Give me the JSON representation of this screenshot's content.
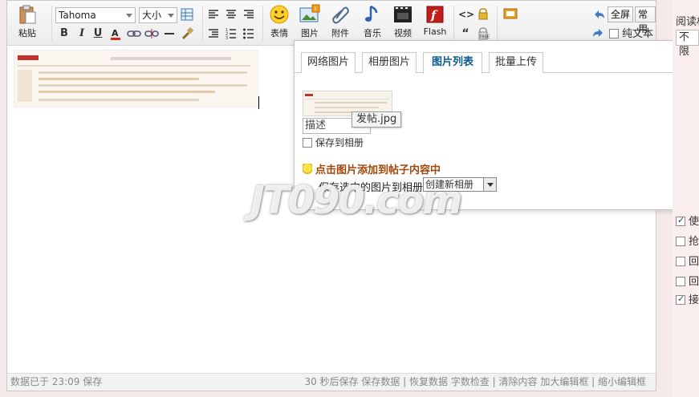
{
  "toolbar": {
    "paste": "粘贴",
    "font_name": "Tahoma",
    "font_size": "大小",
    "emoji": "表情",
    "image": "图片",
    "attachment": "附件",
    "music": "音乐",
    "video": "视频",
    "flash": "Flash",
    "fullscreen": "全屏",
    "common": "常用",
    "plain_text": "纯文本",
    "bold": "B",
    "italic": "I",
    "underline": "U",
    "code_icon": "<>",
    "quote_icon": "“"
  },
  "status": {
    "saved_at": "数据已于 23:09 保存",
    "actions": "30 秒后保存 保存数据 | 恢复数据   字数检查 | 清除内容   加大编辑框 | 缩小编辑框"
  },
  "popup": {
    "tabs": [
      "网络图片",
      "相册图片",
      "图片列表",
      "批量上传"
    ],
    "active_tab": "图片列表",
    "close": "×",
    "desc_placeholder": "描述",
    "filename_tip": "发帖.jpg",
    "save_to_album": "保存到相册",
    "hint": "点击图片添加到帖子内容中",
    "save_selected_label": "保存选中的图片到相册:",
    "album_option": "创建新相册"
  },
  "watermark": "JT090.com",
  "rightpanel": {
    "read_label": "阅读权",
    "limit_value": "不限",
    "opt1": "使",
    "opt2": "抢",
    "opt3": "回",
    "opt4": "回",
    "opt5": "接"
  }
}
